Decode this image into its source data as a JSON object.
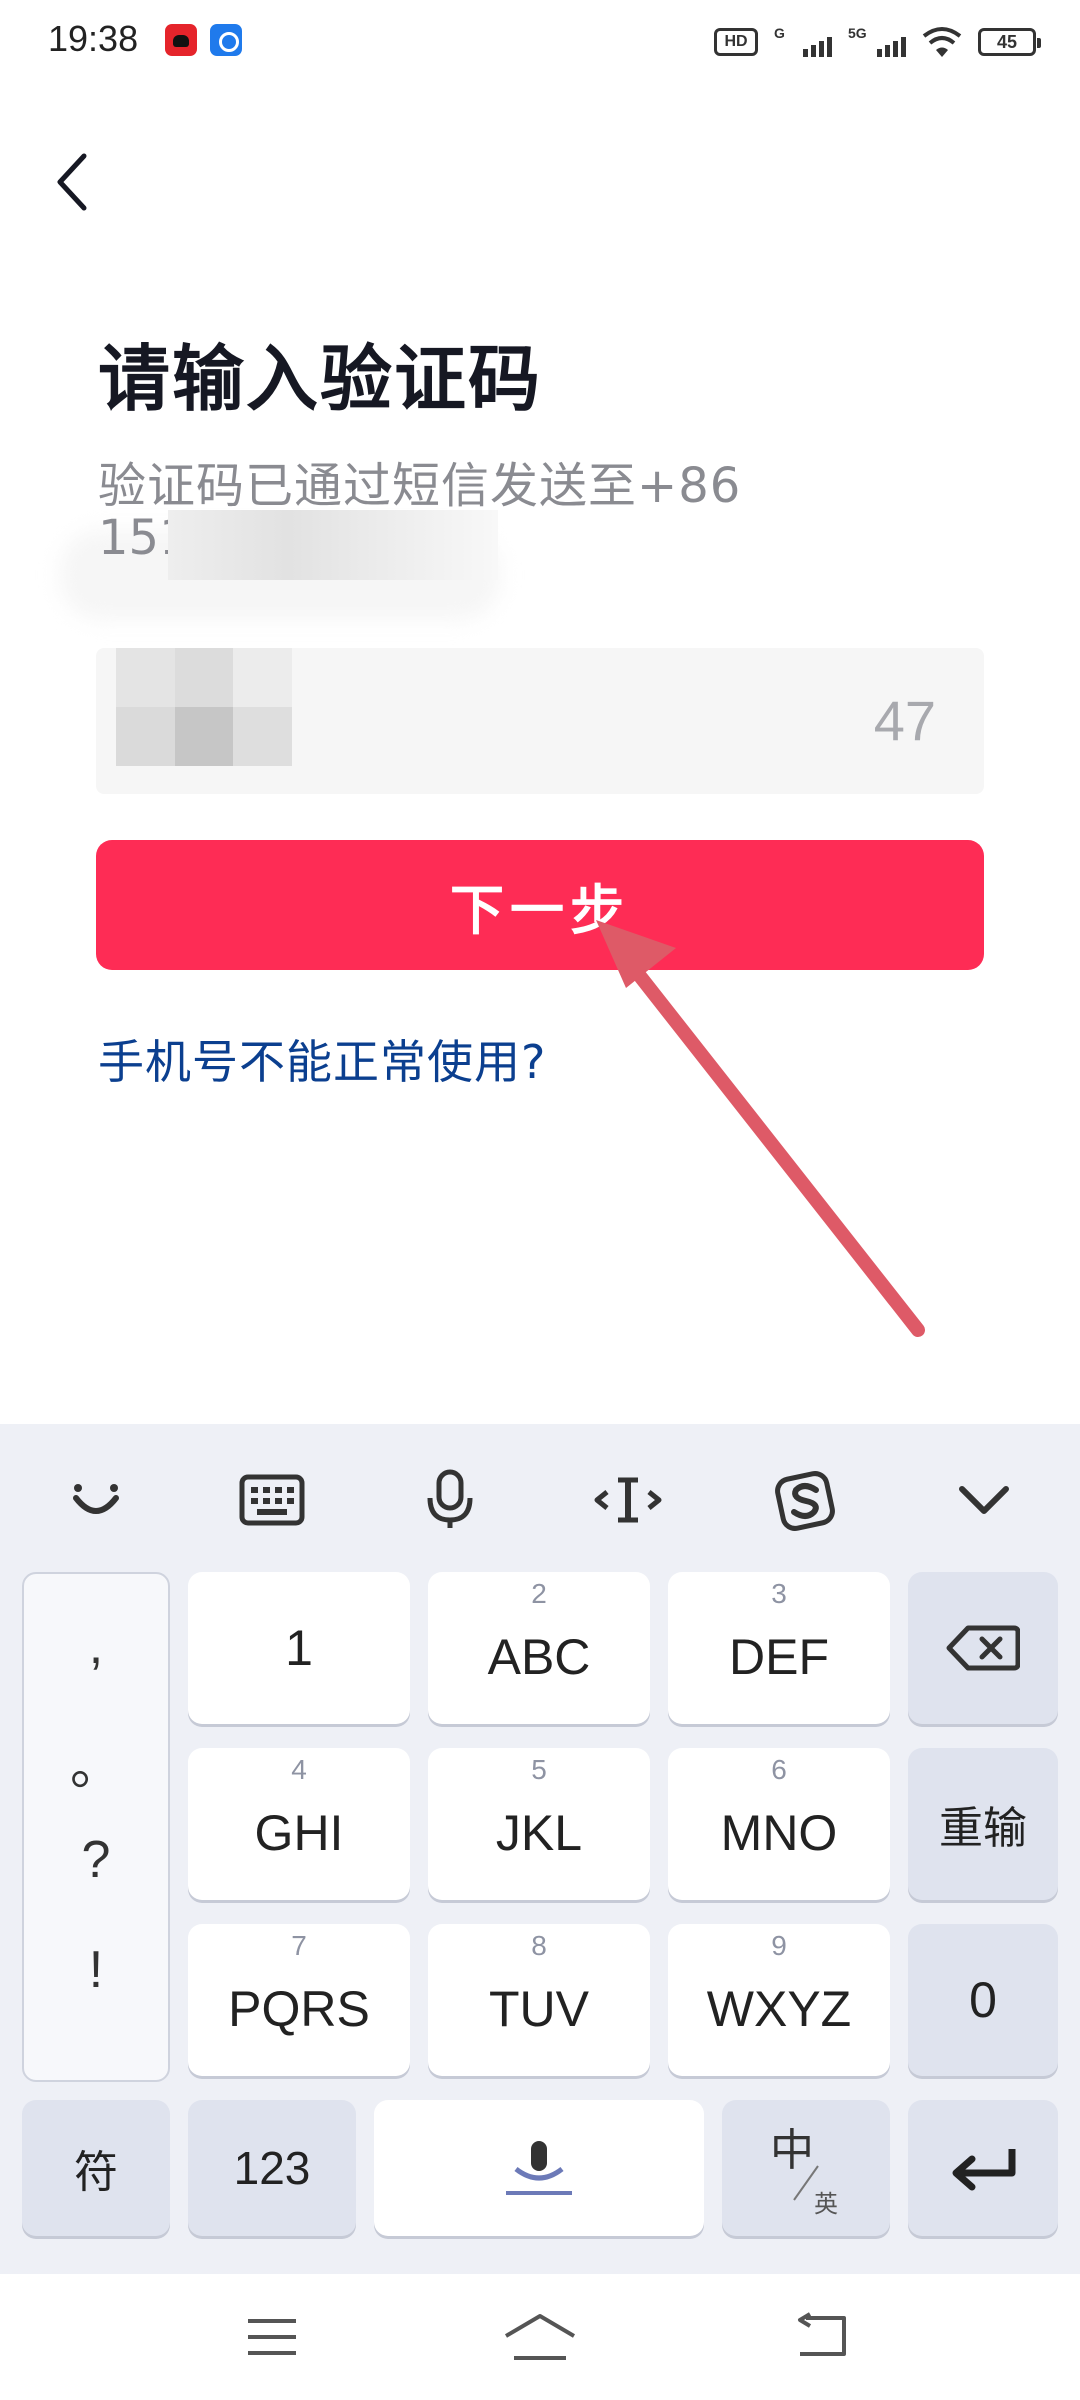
{
  "status_bar": {
    "time": "19:38",
    "hd_label": "HD",
    "signal_1_tag": "G",
    "signal_2_tag": "5G",
    "battery": "45"
  },
  "header": {
    "title": "请输入验证码",
    "subtitle": "验证码已通过短信发送至+86",
    "phone_visible": "151"
  },
  "code_input": {
    "countdown": "47"
  },
  "actions": {
    "next_label": "下一步",
    "help_link": "手机号不能正常使用?"
  },
  "keyboard": {
    "punctuation": [
      ",",
      "。",
      "?",
      "!"
    ],
    "rows": [
      [
        {
          "num": "",
          "label": "1"
        },
        {
          "num": "2",
          "label": "ABC"
        },
        {
          "num": "3",
          "label": "DEF"
        }
      ],
      [
        {
          "num": "4",
          "label": "GHI"
        },
        {
          "num": "5",
          "label": "JKL"
        },
        {
          "num": "6",
          "label": "MNO"
        }
      ],
      [
        {
          "num": "7",
          "label": "PQRS"
        },
        {
          "num": "8",
          "label": "TUV"
        },
        {
          "num": "9",
          "label": "WXYZ"
        }
      ]
    ],
    "reset_label": "重输",
    "zero_label": "0",
    "symbol_label": "符",
    "num_label": "123",
    "lang_main": "中",
    "lang_alt": "英"
  },
  "colors": {
    "accent": "#fe2c55",
    "link": "#0b3f8f",
    "annotation_arrow": "#de5a67"
  },
  "icons": {
    "back": "chevron-left-icon",
    "toolbar": [
      "emoji-icon",
      "keyboard-icon",
      "microphone-icon",
      "text-cursor-icon",
      "sogou-logo-icon",
      "chevron-down-icon"
    ],
    "backspace": "backspace-icon",
    "enter": "enter-icon",
    "space": "microphone-icon",
    "nav": [
      "menu-icon",
      "home-icon",
      "back-icon"
    ]
  }
}
